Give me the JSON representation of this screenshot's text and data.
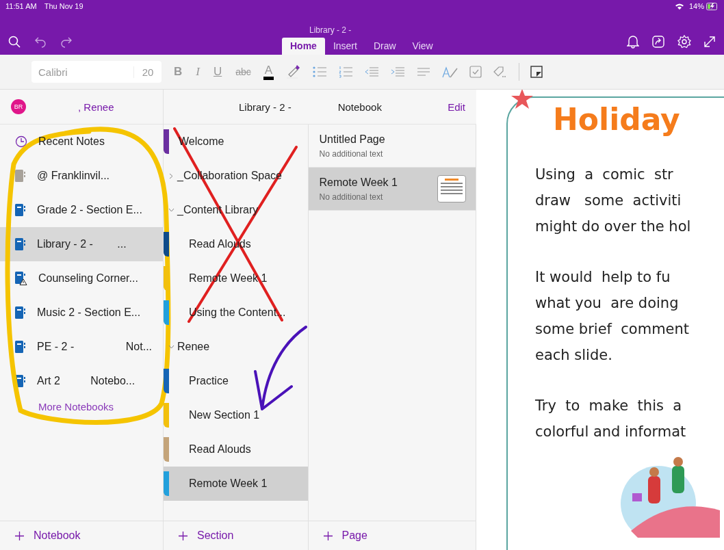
{
  "status_bar": {
    "time": "11:51 AM",
    "date": "Thu Nov 19",
    "battery": "14%"
  },
  "title_bar": {
    "title": "Library - 2 -"
  },
  "tabs": [
    {
      "label": "Home",
      "selected": true
    },
    {
      "label": "Insert",
      "selected": false
    },
    {
      "label": "Draw",
      "selected": false
    },
    {
      "label": "View",
      "selected": false
    }
  ],
  "toolbar": {
    "font": "Calibri",
    "size": "20",
    "buttons": [
      {
        "kind": "bold",
        "label": "B"
      },
      {
        "kind": "italic",
        "label": "I"
      },
      {
        "kind": "underline",
        "label": "U"
      },
      {
        "kind": "strike",
        "label": "abc"
      },
      {
        "kind": "color",
        "label": "A"
      }
    ]
  },
  "account": {
    "initials": "BR",
    "name": ", Renee"
  },
  "notebooks_pane": {
    "recent": "Recent Notes",
    "items": [
      {
        "name": "@ Franklinvil...",
        "kind": "shared",
        "selected": false
      },
      {
        "name": "Grade 2 - Section E...",
        "kind": "notebook",
        "selected": false
      },
      {
        "name": "Library - 2 -        ...",
        "kind": "notebook",
        "selected": true
      },
      {
        "name": "Counseling Corner...",
        "kind": "warning",
        "selected": false
      },
      {
        "name": "Music 2 - Section E...",
        "kind": "notebook",
        "selected": false
      },
      {
        "name": "PE - 2 -                 Not...",
        "kind": "notebook",
        "selected": false
      },
      {
        "name": "Art 2          Notebo...",
        "kind": "notebook",
        "selected": false
      }
    ],
    "more": "More Notebooks",
    "add": "Notebook"
  },
  "sections_pane": {
    "header": "Library - 2 -",
    "header_end": "Notebook",
    "edit": "Edit",
    "items": [
      {
        "name": "Welcome",
        "kind": "section",
        "color": "#6b2fa0",
        "selected": false
      },
      {
        "name": "_Collaboration Space",
        "kind": "group",
        "expanded": false
      },
      {
        "name": "_Content Library",
        "kind": "group",
        "expanded": true,
        "children": [
          {
            "name": "Read Alouds",
            "kind": "section",
            "color": "#0f4c8a",
            "selected": false
          },
          {
            "name": "Remote Week 1",
            "kind": "section",
            "color": "#f2c00d",
            "selected": false
          },
          {
            "name": "Using the Content...",
            "kind": "section",
            "color": "#22a0dc",
            "selected": false
          }
        ]
      },
      {
        "name": "Renee",
        "kind": "group",
        "expanded": true,
        "children": [
          {
            "name": "Practice",
            "kind": "section",
            "color": "#1565b5",
            "selected": false
          },
          {
            "name": "New Section 1",
            "kind": "section",
            "color": "#f2c00d",
            "selected": false
          },
          {
            "name": "Read Alouds",
            "kind": "section",
            "color": "#c4a47a",
            "selected": false
          },
          {
            "name": "Remote Week 1",
            "kind": "section",
            "color": "#22a0dc",
            "selected": true
          }
        ]
      }
    ],
    "add": "Section"
  },
  "pages_pane": {
    "items": [
      {
        "title": "Untitled Page",
        "preview": "No additional text",
        "selected": false,
        "thumbnail": false
      },
      {
        "title": "Remote Week 1",
        "preview": "No additional text",
        "selected": true,
        "thumbnail": true
      }
    ],
    "add": "Page"
  },
  "canvas": {
    "title": "Holiday",
    "paragraphs": [
      [
        "Using  a  comic  str",
        "draw   some  activiti",
        "might do over the hol"
      ],
      [
        "It would  help to fu",
        "what you  are doing",
        "some brief  comment",
        "each slide."
      ],
      [
        "Try  to  make  this  a",
        "colorful and informat"
      ]
    ]
  }
}
